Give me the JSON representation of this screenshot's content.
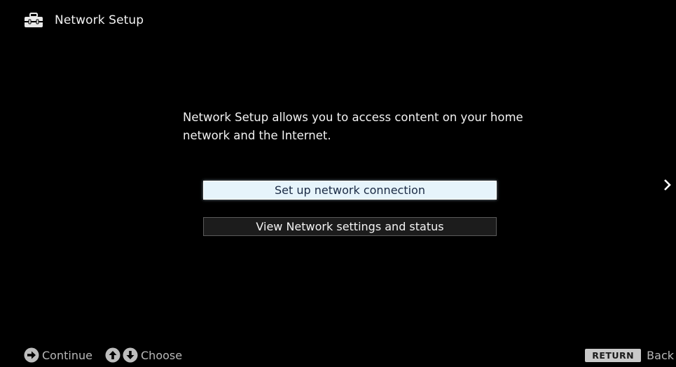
{
  "header": {
    "title": "Network Setup",
    "icon": "toolbox-icon"
  },
  "main": {
    "description": "Network Setup allows you to access content on your home network and the Internet.",
    "options": [
      {
        "label": "Set up network connection",
        "selected": true
      },
      {
        "label": "View Network settings and status",
        "selected": false
      }
    ]
  },
  "footer": {
    "continue_label": "Continue",
    "choose_label": "Choose",
    "return_key": "RETURN",
    "back_label": "Back"
  },
  "colors": {
    "background": "#000000",
    "selected_bg": "#e6f4fb",
    "selected_text": "#1a2a44",
    "unselected_bg": "#1c1c1c"
  }
}
